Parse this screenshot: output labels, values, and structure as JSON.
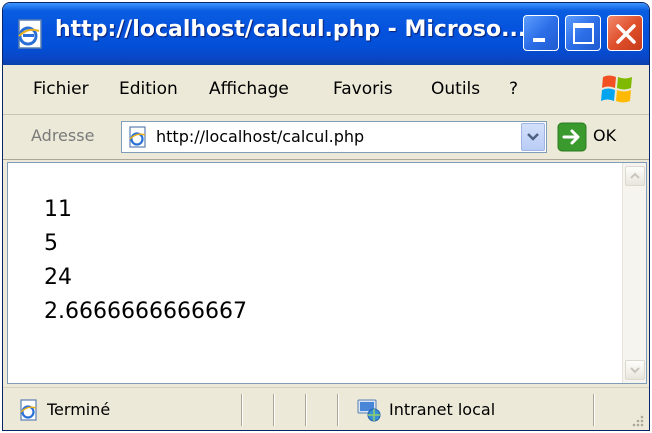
{
  "window": {
    "title": "http://localhost/calcul.php - Microso...",
    "title_icon": "ie-page-icon"
  },
  "menu": {
    "items": [
      "Fichier",
      "Edition",
      "Affichage",
      "Favoris",
      "Outils",
      "?"
    ]
  },
  "address": {
    "label": "Adresse",
    "url": "http://localhost/calcul.php",
    "go_label": "OK"
  },
  "content": {
    "lines": [
      "11",
      "5",
      "24",
      "2.6666666666667"
    ]
  },
  "status": {
    "text": "Terminé",
    "zone": "Intranet local"
  },
  "colors": {
    "titlebar": "#0553de",
    "chrome": "#ece9d8",
    "close_button": "#e0502c",
    "go_arrow": "#3a9a2e"
  }
}
